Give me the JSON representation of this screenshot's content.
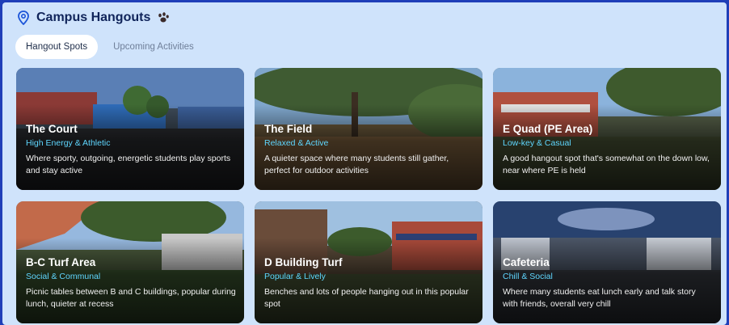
{
  "header": {
    "title": "Campus Hangouts",
    "icon": "map-pin-icon",
    "badge_icon": "paw-icon"
  },
  "tabs": [
    {
      "label": "Hangout Spots",
      "active": true
    },
    {
      "label": "Upcoming Activities",
      "active": false
    }
  ],
  "cards": [
    {
      "name": "The Court",
      "vibe": "High Energy & Athletic",
      "description": "Where sporty, outgoing, energetic students play sports and stay active"
    },
    {
      "name": "The Field",
      "vibe": "Relaxed & Active",
      "description": "A quieter space where many students still gather, perfect for outdoor activities"
    },
    {
      "name": "E Quad (PE Area)",
      "vibe": "Low-key & Casual",
      "description": "A good hangout spot that's somewhat on the down low, near where PE is held"
    },
    {
      "name": "B-C Turf Area",
      "vibe": "Social & Communal",
      "description": "Picnic tables between B and C buildings, popular during lunch, quieter at recess"
    },
    {
      "name": "D Building Turf",
      "vibe": "Popular & Lively",
      "description": "Benches and lots of people hanging out in this popular spot"
    },
    {
      "name": "Cafeteria",
      "vibe": "Chill & Social",
      "description": "Where many students eat lunch early and talk story with friends, overall very chill"
    }
  ],
  "colors": {
    "background": "#1f3fb8",
    "panel": "#cfe3fb",
    "accent": "#5fd7ff",
    "title": "#10245a"
  }
}
